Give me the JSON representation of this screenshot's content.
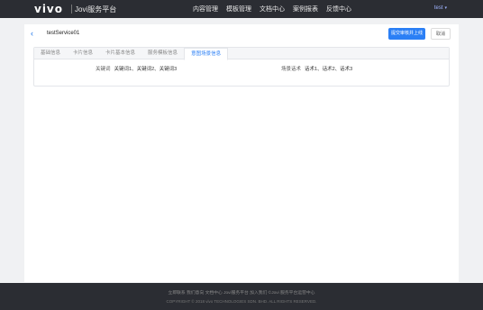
{
  "header": {
    "logo": "vivo",
    "platform": "Jovi服务平台",
    "nav": [
      "内容管理",
      "模板管理",
      "文档中心",
      "案例报表",
      "反馈中心"
    ],
    "user": "test",
    "user_caret": "▾"
  },
  "page": {
    "back_icon": "‹",
    "service_name": "testService01",
    "submit_label": "提交审核并上线",
    "cancel_label": "取消"
  },
  "tabs": [
    "基础信息",
    "卡片信息",
    "卡片基本信息",
    "服务模板信息",
    "意图场景信息"
  ],
  "active_tab": 4,
  "fields": {
    "keywords_label": "关键词",
    "keywords_value": "关键词1、关键词2、关键词3",
    "phrases_label": "场景话术",
    "phrases_value": "话术1、话术2、话术3"
  },
  "footer": {
    "links": "立即联系   我们意向   文档中心 Jovi服务平台   加入我们   ©Jovi 服务平台运营中心",
    "copyright": "COPYRIGHT © 2018 vivo TECHNOLOGIES SDN. BHD. ALL RIGHTS RESERVED."
  }
}
